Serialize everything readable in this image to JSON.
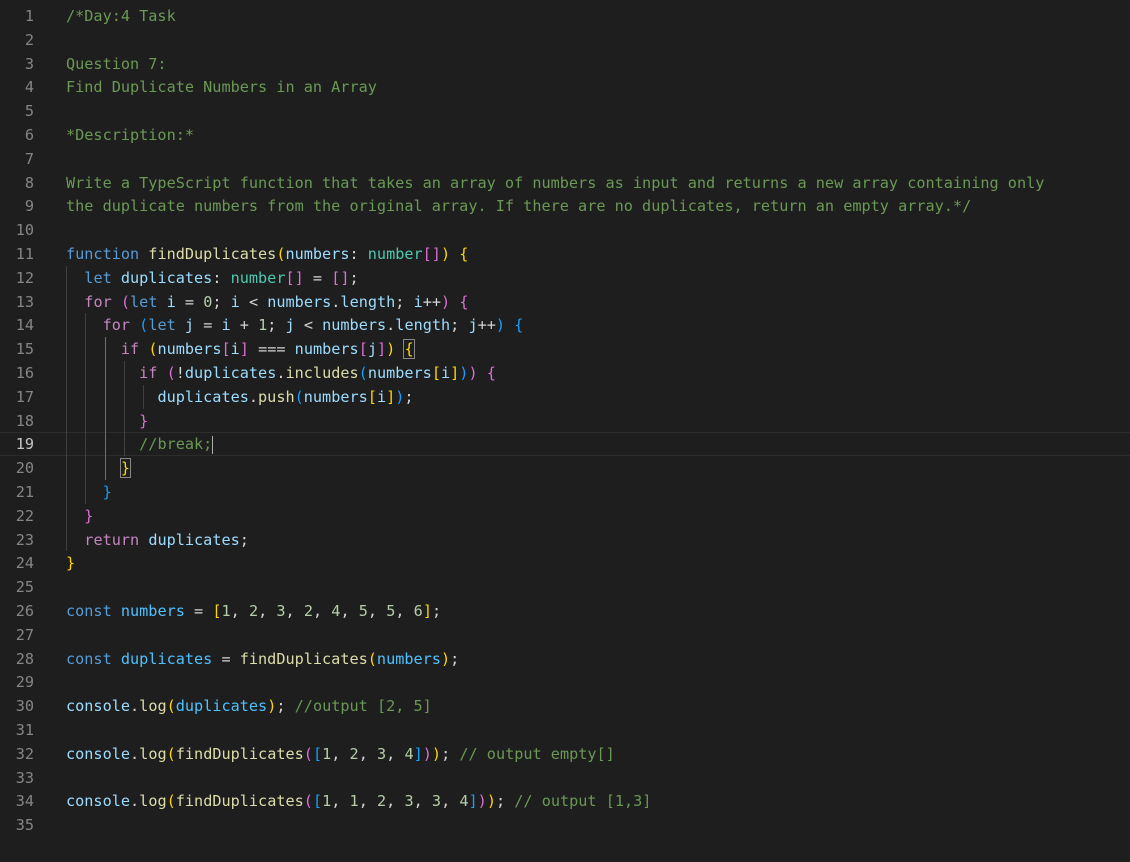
{
  "editor": {
    "language": "typescript",
    "active_line": 19,
    "lines": [
      [
        [
          "cm",
          "/*Day:4 Task"
        ]
      ],
      [],
      [
        [
          "cm",
          "Question 7:"
        ]
      ],
      [
        [
          "cm",
          "Find Duplicate Numbers in an Array"
        ]
      ],
      [],
      [
        [
          "cm",
          "*Description:*"
        ]
      ],
      [],
      [
        [
          "cm",
          "Write a TypeScript function that takes an array of numbers as input and returns a new array containing only"
        ]
      ],
      [
        [
          "cm",
          "the duplicate numbers from the original array. If there are no duplicates, return an empty array.*/"
        ]
      ],
      [],
      [
        [
          "kw",
          "function "
        ],
        [
          "fn",
          "findDuplicates"
        ],
        [
          "b1",
          "("
        ],
        [
          "var",
          "numbers"
        ],
        [
          "op",
          ": "
        ],
        [
          "typ",
          "number"
        ],
        [
          "b2",
          "[]"
        ],
        [
          "b1",
          ")"
        ],
        [
          "op",
          " "
        ],
        [
          "b1",
          "{"
        ]
      ],
      [
        [
          "op",
          "  "
        ],
        [
          "kw",
          "let "
        ],
        [
          "var",
          "duplicates"
        ],
        [
          "op",
          ": "
        ],
        [
          "typ",
          "number"
        ],
        [
          "b2",
          "[]"
        ],
        [
          "op",
          " = "
        ],
        [
          "b2",
          "[]"
        ],
        [
          "op",
          ";"
        ]
      ],
      [
        [
          "op",
          "  "
        ],
        [
          "ctl",
          "for "
        ],
        [
          "b2",
          "("
        ],
        [
          "kw",
          "let "
        ],
        [
          "var",
          "i"
        ],
        [
          "op",
          " = "
        ],
        [
          "num",
          "0"
        ],
        [
          "op",
          "; "
        ],
        [
          "var",
          "i"
        ],
        [
          "op",
          " < "
        ],
        [
          "var",
          "numbers"
        ],
        [
          "op",
          "."
        ],
        [
          "var",
          "length"
        ],
        [
          "op",
          "; "
        ],
        [
          "var",
          "i"
        ],
        [
          "op",
          "++"
        ],
        [
          "b2",
          ")"
        ],
        [
          "op",
          " "
        ],
        [
          "b2",
          "{"
        ]
      ],
      [
        [
          "op",
          "    "
        ],
        [
          "ctl",
          "for "
        ],
        [
          "b3",
          "("
        ],
        [
          "kw",
          "let "
        ],
        [
          "var",
          "j"
        ],
        [
          "op",
          " = "
        ],
        [
          "var",
          "i"
        ],
        [
          "op",
          " + "
        ],
        [
          "num",
          "1"
        ],
        [
          "op",
          "; "
        ],
        [
          "var",
          "j"
        ],
        [
          "op",
          " < "
        ],
        [
          "var",
          "numbers"
        ],
        [
          "op",
          "."
        ],
        [
          "var",
          "length"
        ],
        [
          "op",
          "; "
        ],
        [
          "var",
          "j"
        ],
        [
          "op",
          "++"
        ],
        [
          "b3",
          ")"
        ],
        [
          "op",
          " "
        ],
        [
          "b3",
          "{"
        ]
      ],
      [
        [
          "op",
          "      "
        ],
        [
          "ctl",
          "if "
        ],
        [
          "b1",
          "("
        ],
        [
          "var",
          "numbers"
        ],
        [
          "b2",
          "["
        ],
        [
          "var",
          "i"
        ],
        [
          "b2",
          "]"
        ],
        [
          "op",
          " === "
        ],
        [
          "var",
          "numbers"
        ],
        [
          "b2",
          "["
        ],
        [
          "var",
          "j"
        ],
        [
          "b2",
          "]"
        ],
        [
          "b1",
          ")"
        ],
        [
          "op",
          " "
        ],
        [
          "b1m",
          "{"
        ]
      ],
      [
        [
          "op",
          "        "
        ],
        [
          "ctl",
          "if "
        ],
        [
          "b2",
          "("
        ],
        [
          "op",
          "!"
        ],
        [
          "var",
          "duplicates"
        ],
        [
          "op",
          "."
        ],
        [
          "fn",
          "includes"
        ],
        [
          "b3",
          "("
        ],
        [
          "var",
          "numbers"
        ],
        [
          "b1",
          "["
        ],
        [
          "var",
          "i"
        ],
        [
          "b1",
          "]"
        ],
        [
          "b3",
          ")"
        ],
        [
          "b2",
          ")"
        ],
        [
          "op",
          " "
        ],
        [
          "b2",
          "{"
        ]
      ],
      [
        [
          "op",
          "          "
        ],
        [
          "var",
          "duplicates"
        ],
        [
          "op",
          "."
        ],
        [
          "fn",
          "push"
        ],
        [
          "b3",
          "("
        ],
        [
          "var",
          "numbers"
        ],
        [
          "b1",
          "["
        ],
        [
          "var",
          "i"
        ],
        [
          "b1",
          "]"
        ],
        [
          "b3",
          ")"
        ],
        [
          "op",
          ";"
        ]
      ],
      [
        [
          "op",
          "        "
        ],
        [
          "b2",
          "}"
        ]
      ],
      [
        [
          "op",
          "        "
        ],
        [
          "cm",
          "//break;"
        ],
        [
          "cursor",
          ""
        ]
      ],
      [
        [
          "op",
          "      "
        ],
        [
          "b1m",
          "}"
        ]
      ],
      [
        [
          "op",
          "    "
        ],
        [
          "b3",
          "}"
        ]
      ],
      [
        [
          "op",
          "  "
        ],
        [
          "b2",
          "}"
        ]
      ],
      [
        [
          "op",
          "  "
        ],
        [
          "ctl",
          "return "
        ],
        [
          "var",
          "duplicates"
        ],
        [
          "op",
          ";"
        ]
      ],
      [
        [
          "b1",
          "}"
        ]
      ],
      [],
      [
        [
          "kw",
          "const "
        ],
        [
          "cst",
          "numbers"
        ],
        [
          "op",
          " = "
        ],
        [
          "b1",
          "["
        ],
        [
          "num",
          "1"
        ],
        [
          "op",
          ", "
        ],
        [
          "num",
          "2"
        ],
        [
          "op",
          ", "
        ],
        [
          "num",
          "3"
        ],
        [
          "op",
          ", "
        ],
        [
          "num",
          "2"
        ],
        [
          "op",
          ", "
        ],
        [
          "num",
          "4"
        ],
        [
          "op",
          ", "
        ],
        [
          "num",
          "5"
        ],
        [
          "op",
          ", "
        ],
        [
          "num",
          "5"
        ],
        [
          "op",
          ", "
        ],
        [
          "num",
          "6"
        ],
        [
          "b1",
          "]"
        ],
        [
          "op",
          ";"
        ]
      ],
      [],
      [
        [
          "kw",
          "const "
        ],
        [
          "cst",
          "duplicates"
        ],
        [
          "op",
          " = "
        ],
        [
          "fn",
          "findDuplicates"
        ],
        [
          "b1",
          "("
        ],
        [
          "cst",
          "numbers"
        ],
        [
          "b1",
          ")"
        ],
        [
          "op",
          ";"
        ]
      ],
      [],
      [
        [
          "var",
          "console"
        ],
        [
          "op",
          "."
        ],
        [
          "fn",
          "log"
        ],
        [
          "b1",
          "("
        ],
        [
          "cst",
          "duplicates"
        ],
        [
          "b1",
          ")"
        ],
        [
          "op",
          "; "
        ],
        [
          "cm",
          "//output [2, 5]"
        ]
      ],
      [],
      [
        [
          "var",
          "console"
        ],
        [
          "op",
          "."
        ],
        [
          "fn",
          "log"
        ],
        [
          "b1",
          "("
        ],
        [
          "fn",
          "findDuplicates"
        ],
        [
          "b2",
          "("
        ],
        [
          "b3",
          "["
        ],
        [
          "num",
          "1"
        ],
        [
          "op",
          ", "
        ],
        [
          "num",
          "2"
        ],
        [
          "op",
          ", "
        ],
        [
          "num",
          "3"
        ],
        [
          "op",
          ", "
        ],
        [
          "num",
          "4"
        ],
        [
          "b3",
          "]"
        ],
        [
          "b2",
          ")"
        ],
        [
          "b1",
          ")"
        ],
        [
          "op",
          "; "
        ],
        [
          "cm",
          "// output empty[]"
        ]
      ],
      [],
      [
        [
          "var",
          "console"
        ],
        [
          "op",
          "."
        ],
        [
          "fn",
          "log"
        ],
        [
          "b1",
          "("
        ],
        [
          "fn",
          "findDuplicates"
        ],
        [
          "b2",
          "("
        ],
        [
          "b3",
          "["
        ],
        [
          "num",
          "1"
        ],
        [
          "op",
          ", "
        ],
        [
          "num",
          "1"
        ],
        [
          "op",
          ", "
        ],
        [
          "num",
          "2"
        ],
        [
          "op",
          ", "
        ],
        [
          "num",
          "3"
        ],
        [
          "op",
          ", "
        ],
        [
          "num",
          "3"
        ],
        [
          "op",
          ", "
        ],
        [
          "num",
          "4"
        ],
        [
          "b3",
          "]"
        ],
        [
          "b2",
          ")"
        ],
        [
          "b1",
          ")"
        ],
        [
          "op",
          "; "
        ],
        [
          "cm",
          "// output [1,3]"
        ]
      ],
      []
    ]
  }
}
